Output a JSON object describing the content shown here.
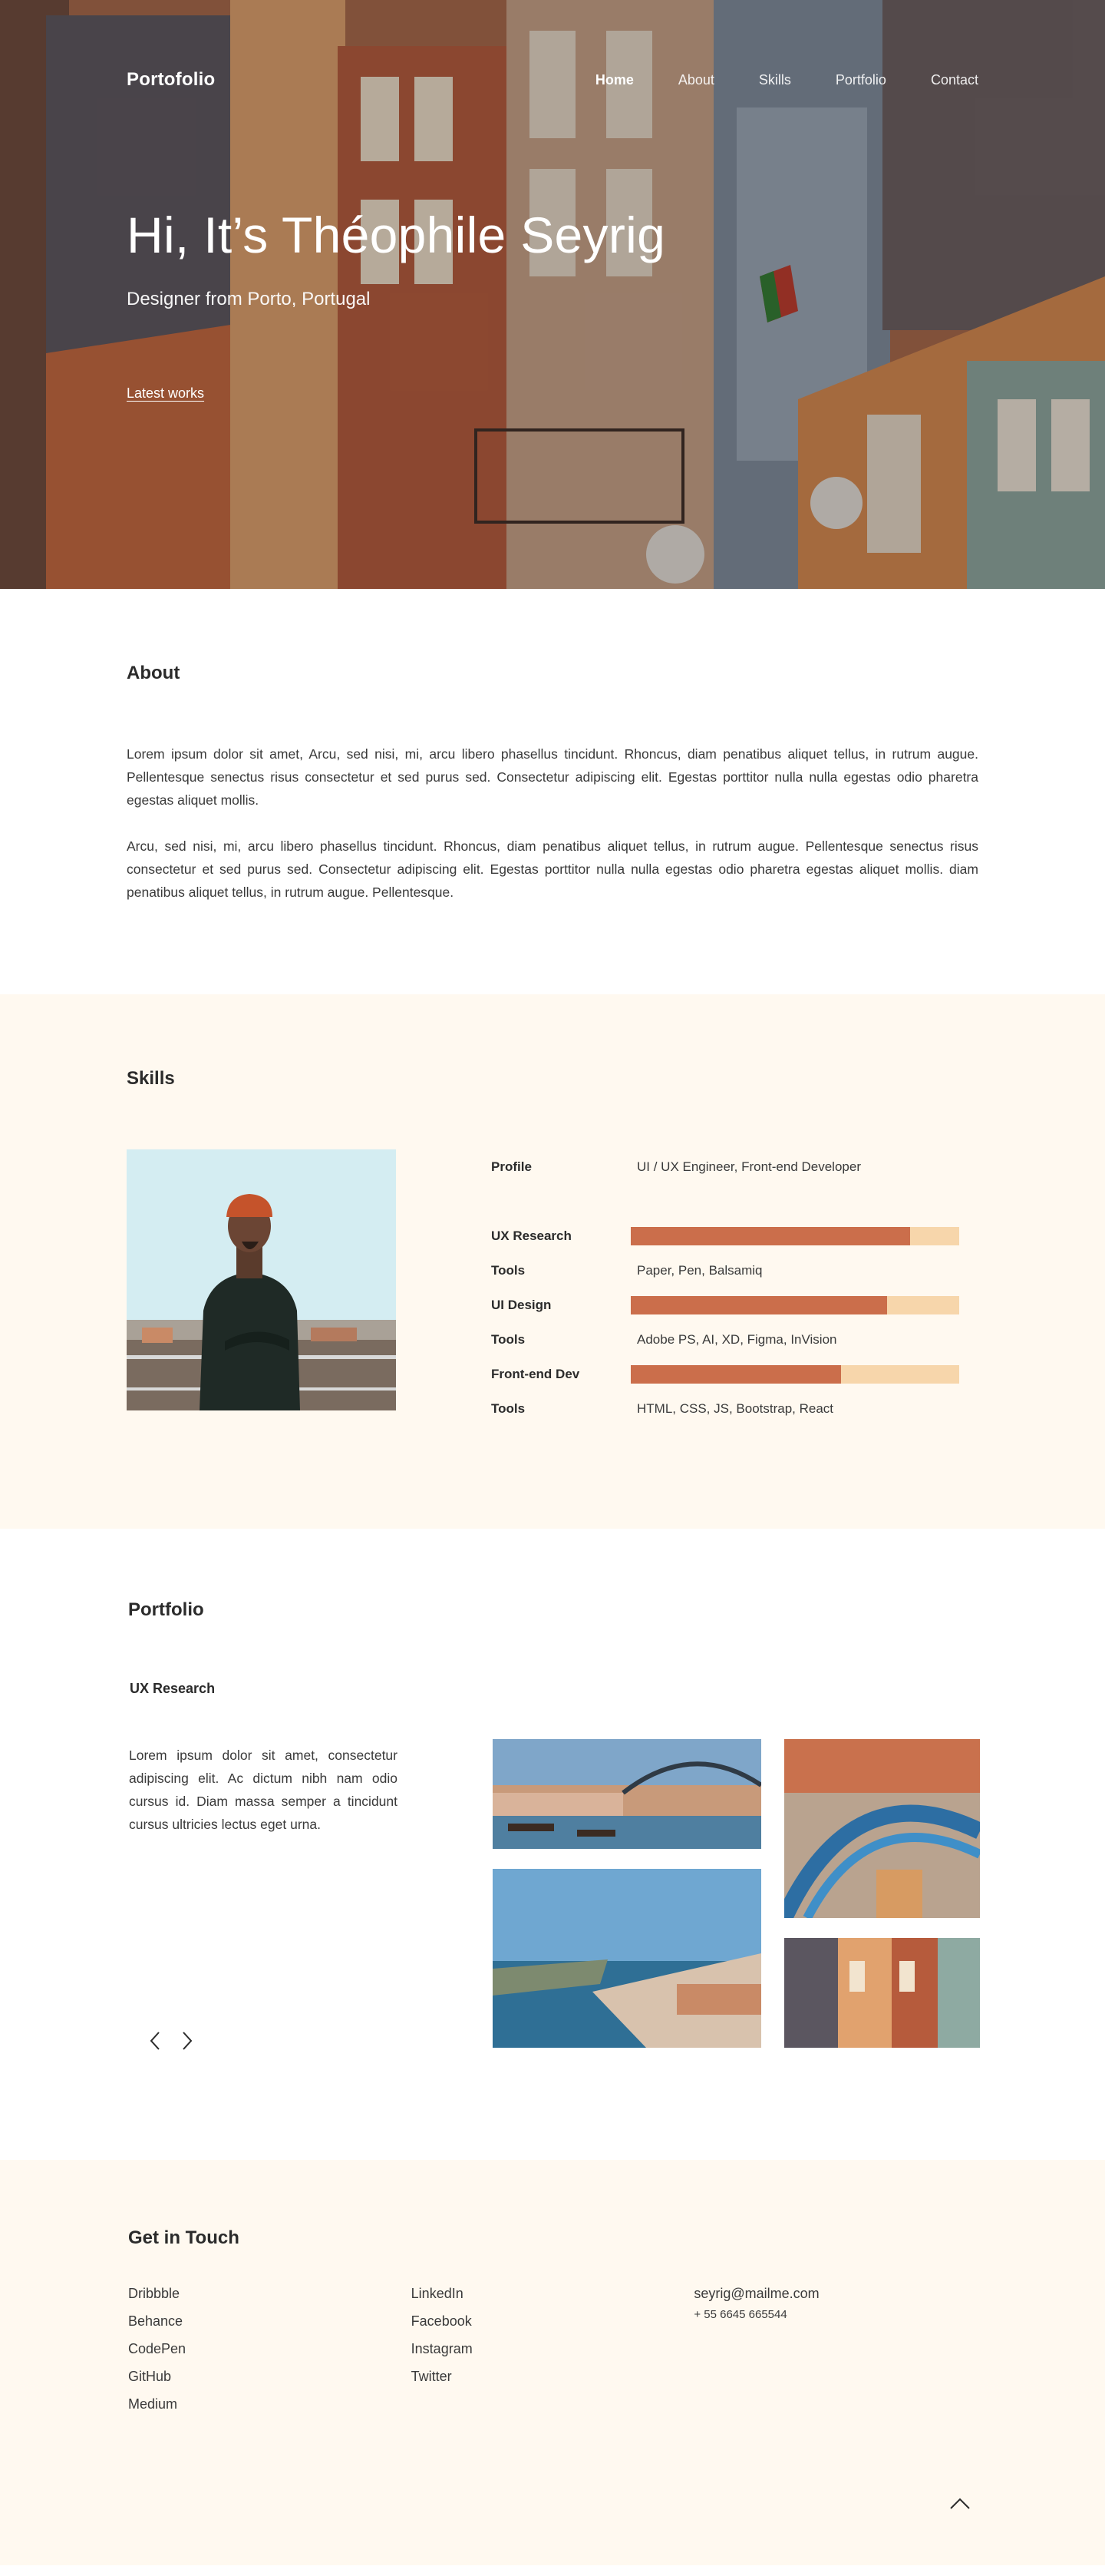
{
  "nav": {
    "logo": "Portofolio",
    "links": [
      {
        "label": "Home"
      },
      {
        "label": "About"
      },
      {
        "label": "Skills"
      },
      {
        "label": "Portfolio"
      },
      {
        "label": "Contact"
      }
    ]
  },
  "hero": {
    "title": "Hi, It’s Théophile Seyrig",
    "subtitle": "Designer from Porto, Portugal",
    "link": "Latest works"
  },
  "about": {
    "title": "About",
    "paragraphs": [
      "Lorem ipsum dolor sit amet, Arcu, sed nisi, mi, arcu libero phasellus tincidunt. Rhoncus, diam penatibus aliquet tellus, in rutrum augue. Pellentesque senectus risus consectetur et sed purus sed. Consectetur adipiscing elit. Egestas porttitor nulla nulla egestas odio pharetra egestas aliquet mollis.",
      "Arcu, sed nisi, mi, arcu libero phasellus tincidunt. Rhoncus, diam penatibus aliquet tellus, in rutrum augue. Pellentesque senectus risus consectetur et sed purus sed. Consectetur adipiscing elit. Egestas porttitor nulla nulla egestas odio pharetra egestas aliquet mollis. diam penatibus aliquet tellus, in rutrum augue. Pellentesque."
    ]
  },
  "skills": {
    "title": "Skills",
    "profile_label": "Profile",
    "profile_value": "UI / UX Engineer, Front-end Developer",
    "items": [
      {
        "name": "UX Research",
        "level": 0.85,
        "tools_label": "Tools",
        "tools": "Paper, Pen, Balsamiq"
      },
      {
        "name": "UI Design",
        "level": 0.78,
        "tools_label": "Tools",
        "tools": "Adobe PS, AI, XD, Figma, InVision"
      },
      {
        "name": "Front-end Dev",
        "level": 0.64,
        "tools_label": "Tools",
        "tools": "HTML, CSS, JS, Bootstrap, React"
      }
    ],
    "colors": {
      "bar_fill": "#cb6e4b",
      "bar_track": "#f7d6ab"
    }
  },
  "portfolio": {
    "title": "Portfolio",
    "subtitle": "UX Research",
    "text": "Lorem ipsum dolor sit amet, consectetur adipiscing elit. Ac dictum nibh nam odio cursus id. Diam massa semper a tincidunt cursus ultricies lectus eget urna."
  },
  "contact": {
    "title": "Get in Touch",
    "col1": [
      "Dribbble",
      "Behance",
      "CodePen",
      "GitHub",
      "Medium"
    ],
    "col2": [
      "LinkedIn",
      "Facebook",
      "Instagram",
      "Twitter"
    ],
    "email": "seyrig@mailme.com",
    "phone": "+ 55 6645 665544"
  },
  "colors": {
    "accent": "#cb6e4b",
    "section_bg": "#fff9f0"
  }
}
